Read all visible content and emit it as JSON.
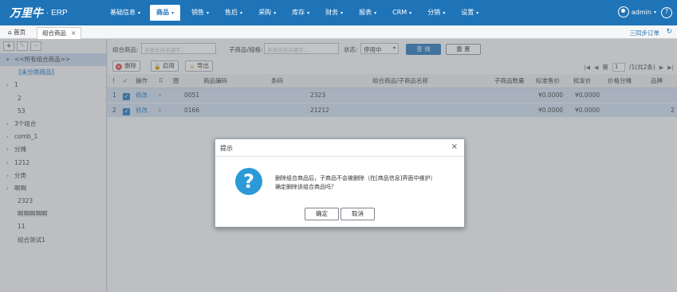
{
  "app": {
    "brand": "万里牛",
    "suffix": "· ERP"
  },
  "nav": [
    {
      "label": "基础信息"
    },
    {
      "label": "商品"
    },
    {
      "label": "销售"
    },
    {
      "label": "售后"
    },
    {
      "label": "采购"
    },
    {
      "label": "库存"
    },
    {
      "label": "财务"
    },
    {
      "label": "报表"
    },
    {
      "label": "CRM"
    },
    {
      "label": "分销"
    },
    {
      "label": "设置"
    }
  ],
  "user": {
    "name": "admin"
  },
  "tabs": {
    "home": "首页",
    "active": "组合商品",
    "close": "×"
  },
  "toolbar_right": {
    "sync": "三同步订单",
    "refresh": "↻"
  },
  "tree": {
    "root": "<<所有组合商品>>",
    "uncategorized": "[未分类商品]",
    "items": [
      "1",
      "2",
      "53",
      "3个组合",
      "comb_1",
      "分摊",
      "1212",
      "分类",
      "啊啊",
      "2323",
      "啊啊啊啊啊",
      "11",
      "组合测试1"
    ]
  },
  "filter": {
    "label_combo": "组合商品:",
    "placeholder_combo": "多款支持关键字...",
    "label_child": "子商品/规格:",
    "placeholder_child": "多款支持关键字...",
    "label_status": "状态:",
    "status_value": "停用中",
    "query": "查 询",
    "reset": "重 置"
  },
  "actions": {
    "delete": "删除",
    "enable": "启用",
    "export": "导出"
  },
  "pager": {
    "page_label": "第",
    "page": "1",
    "total": "/1(共2条)"
  },
  "grid": {
    "headers": {
      "num": "!",
      "check": "✓",
      "op": "操作",
      "expand": "",
      "img": "图",
      "code": "商品编码",
      "barcode": "条码",
      "name": "组合商品/子商品名称",
      "qty": "子商品数量",
      "std_price": "标准售价",
      "wholesale": "批发价",
      "price_split": "价格分摊",
      "brand": "品牌"
    },
    "rows": [
      {
        "num": "1",
        "op": "修改",
        "code": "0051",
        "barcode": "",
        "name": "2323",
        "qty": "",
        "std_price": "¥0.0000",
        "wholesale": "¥0.0000",
        "price_split": "",
        "brand": ""
      },
      {
        "num": "2",
        "op": "修改",
        "code": "0166",
        "barcode": "",
        "name": "21212",
        "qty": "",
        "std_price": "¥0.0000",
        "wholesale": "¥0.0000",
        "price_split": "",
        "brand": "2"
      }
    ]
  },
  "modal": {
    "title": "提示",
    "message_line1": "删除组合商品后，子商品不会被删除（在[商品信息]界面中维护）",
    "message_line2": "确定删除该组合商品吗？",
    "ok": "确定",
    "cancel": "取消"
  }
}
